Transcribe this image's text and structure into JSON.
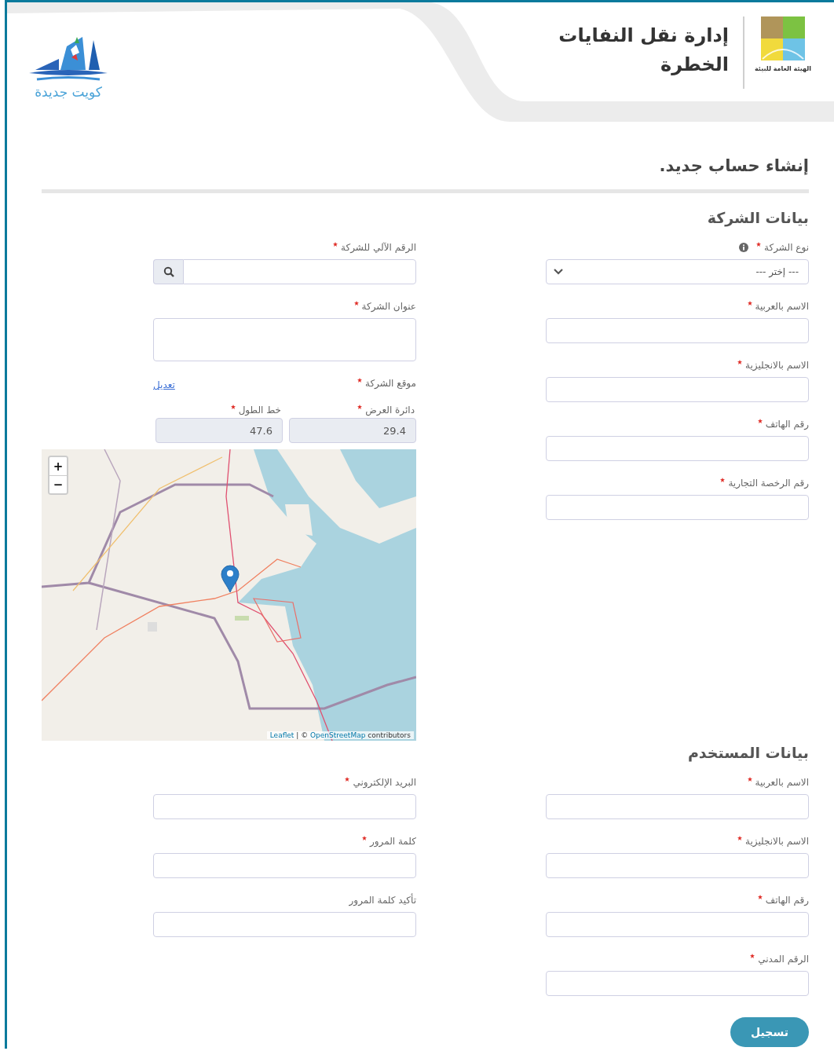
{
  "header": {
    "agency_name": "الهيئة العامة للبيئة",
    "title": "إدارة نقل النفايات الخطرة",
    "logo_text": "كويت جديدة"
  },
  "page_title": "إنشاء حساب جديد.",
  "sections": [
    {
      "title": "بيانات الشركة",
      "columns": [
        [
          {
            "kind": "select",
            "label": "نوع الشركة",
            "required": true,
            "info": true,
            "value": "--- إختر ---"
          },
          {
            "kind": "text",
            "label": "الاسم بالعربية",
            "required": true
          },
          {
            "kind": "text",
            "label": "الاسم بالانجليزية",
            "required": true
          },
          {
            "kind": "text",
            "label": "رقم الهاتف",
            "required": true
          },
          {
            "kind": "text",
            "label": "رقم الرخصة التجارية",
            "required": true
          }
        ],
        [
          {
            "kind": "search",
            "label": "الرقم الآلي للشركة",
            "required": true
          },
          {
            "kind": "textarea",
            "label": "عنوان الشركة",
            "required": true
          },
          {
            "kind": "location",
            "label": "موقع الشركة",
            "required": true,
            "edit_link": "تعديل",
            "coordinates": [
              {
                "label": "دائرة العرض",
                "required": true,
                "value": "29.4"
              },
              {
                "label": "خط الطول",
                "required": true,
                "value": "47.6"
              }
            ],
            "map": {
              "zoom_in": "+",
              "zoom_out": "−",
              "attribution_first_link": "Leaflet",
              "attribution_separator": "| ©",
              "attribution_second_link": "OpenStreetMap",
              "attribution_suffix": "contributors"
            }
          }
        ]
      ]
    },
    {
      "title": "بيانات المستخدم",
      "columns": [
        [
          {
            "kind": "text",
            "label": "الاسم بالعربية",
            "required": true
          },
          {
            "kind": "text",
            "label": "الاسم بالانجليزية",
            "required": true
          },
          {
            "kind": "text",
            "label": "رقم الهاتف",
            "required": true
          },
          {
            "kind": "text",
            "label": "الرقم المدني",
            "required": true
          }
        ],
        [
          {
            "kind": "text",
            "label": "البريد الإلكتروني",
            "required": true
          },
          {
            "kind": "text",
            "label": "كلمة المرور",
            "required": true
          },
          {
            "kind": "text",
            "label": "تأكيد كلمة المرور",
            "required": false
          }
        ]
      ]
    }
  ],
  "submit_button": "تسجيل"
}
